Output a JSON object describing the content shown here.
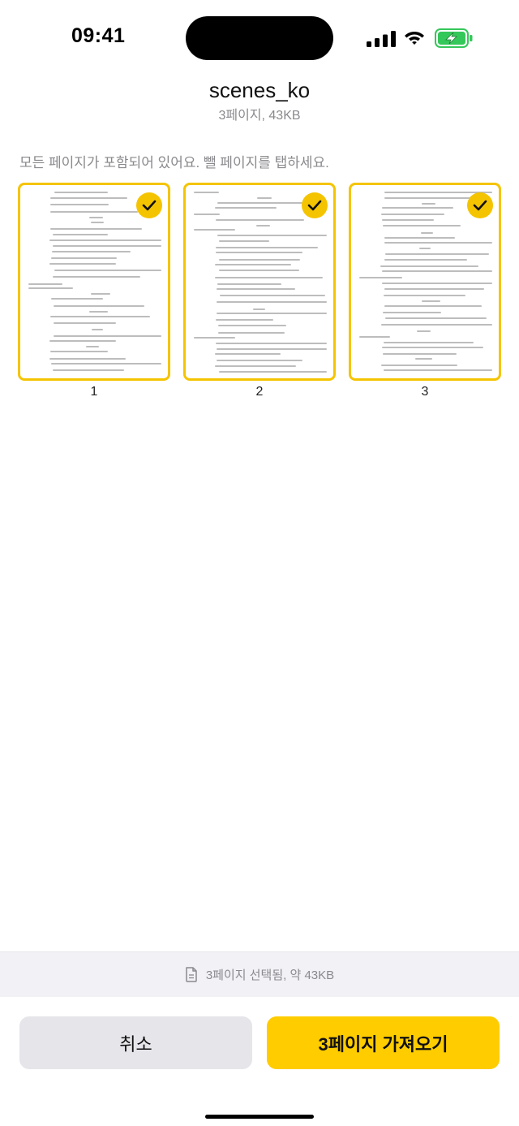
{
  "status_bar": {
    "time": "09:41"
  },
  "header": {
    "title": "scenes_ko",
    "subtitle": "3페이지, 43KB"
  },
  "hint": "모든 페이지가 포함되어 있어요. 뺄 페이지를 탭하세요.",
  "pages": [
    {
      "number": "1",
      "selected": true
    },
    {
      "number": "2",
      "selected": true
    },
    {
      "number": "3",
      "selected": true
    }
  ],
  "summary": {
    "icon": "document-icon",
    "text": "3페이지 선택됨, 약 43KB"
  },
  "buttons": {
    "cancel": "취소",
    "import": "3페이지 가져오기"
  },
  "colors": {
    "accent": "#ffcc00",
    "secondary_button": "#e5e5ea",
    "muted_text": "#8a8a8e"
  }
}
